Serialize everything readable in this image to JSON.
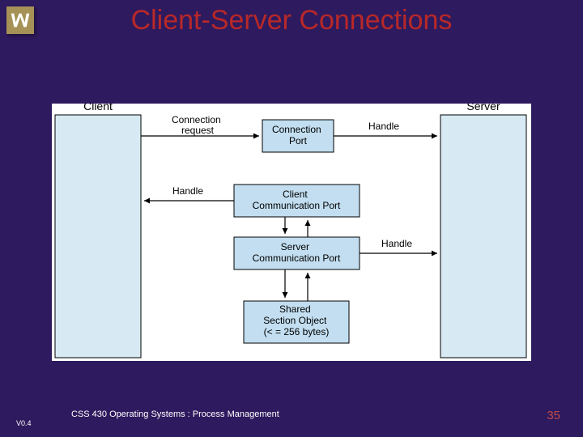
{
  "slide": {
    "title": "Client-Server Connections",
    "version": "V0.4",
    "footer": "CSS 430 Operating Systems : Process Management",
    "page": "35"
  },
  "diagram": {
    "client_label": "Client",
    "server_label": "Server",
    "connection_request": "Connection\nrequest",
    "handle1": "Handle",
    "handle2": "Handle",
    "handle3": "Handle",
    "box_connection_port": "Connection\nPort",
    "box_client_comm": "Client\nCommunication Port",
    "box_server_comm": "Server\nCommunication Port",
    "box_shared": "Shared\nSection Object\n(< = 256 bytes)"
  }
}
